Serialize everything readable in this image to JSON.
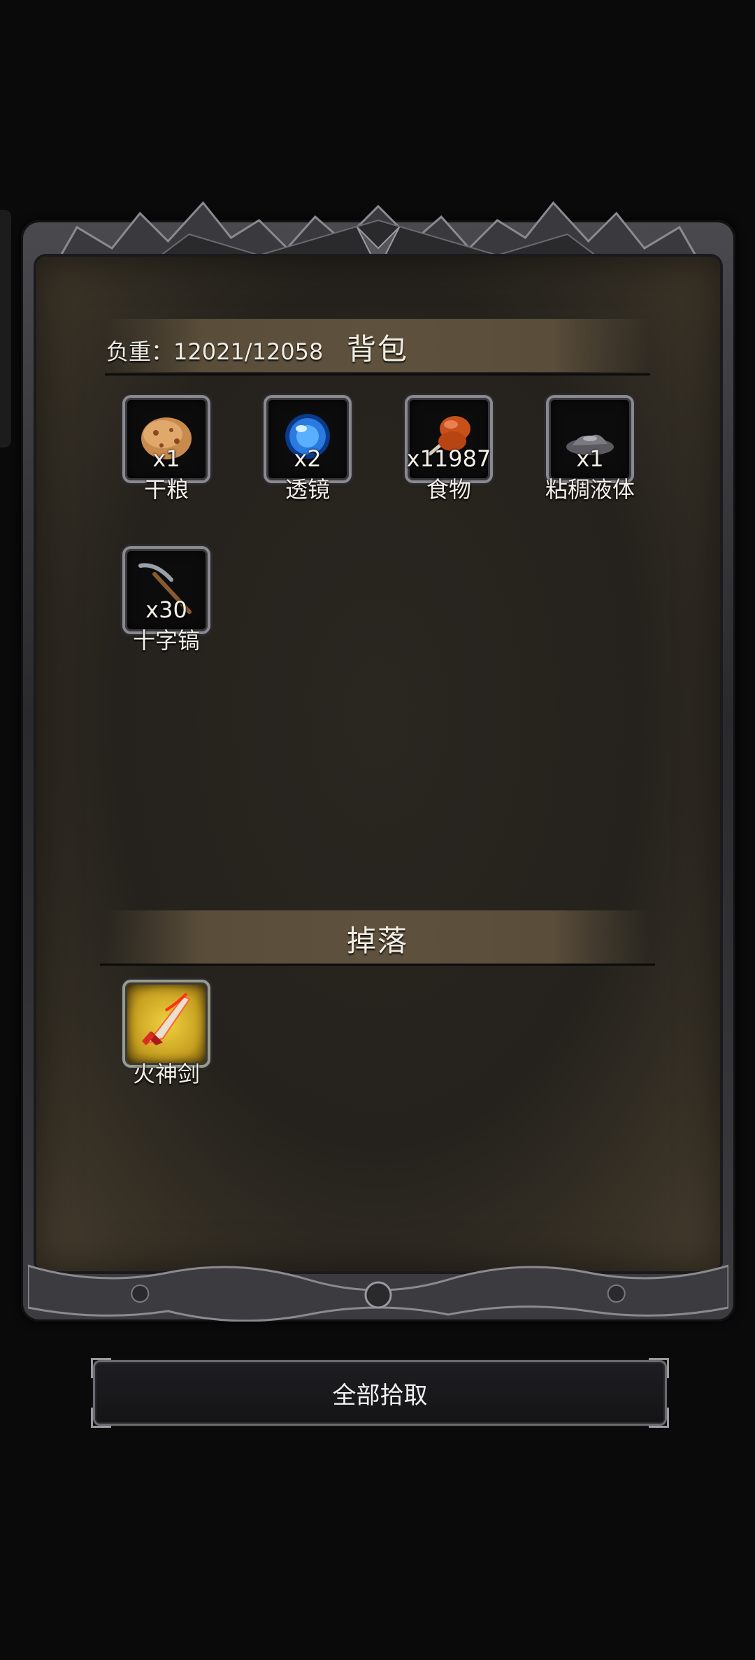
{
  "backpack": {
    "title": "背包",
    "weight_label": "负重：12021/12058",
    "items": [
      {
        "name": "干粮",
        "qty": "x1",
        "icon": "dry-ration-icon"
      },
      {
        "name": "透镜",
        "qty": "x2",
        "icon": "lens-orb-icon"
      },
      {
        "name": "食物",
        "qty": "x11987",
        "icon": "meat-drumstick-icon"
      },
      {
        "name": "粘稠液体",
        "qty": "x1",
        "icon": "viscous-liquid-icon"
      },
      {
        "name": "十字镐",
        "qty": "x30",
        "icon": "pickaxe-icon"
      }
    ]
  },
  "drops": {
    "title": "掉落",
    "items": [
      {
        "name": "火神剑",
        "qty": "",
        "icon": "fire-god-sword-icon"
      }
    ]
  },
  "actions": {
    "pickup_all": "全部拾取"
  },
  "colors": {
    "panel_bg": "#25221d",
    "header_bar": "#5a4e3a",
    "frame_metal": "#4a4a4e",
    "rare_slot": "#c8a020"
  }
}
